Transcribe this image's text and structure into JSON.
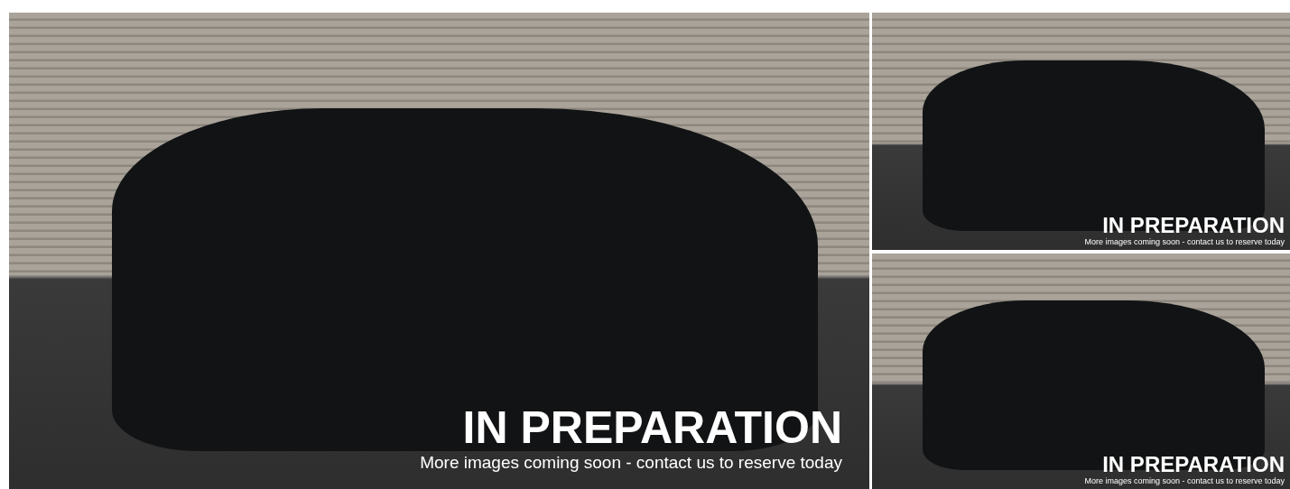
{
  "gallery": [
    {
      "kind": "main",
      "overlay_title": "IN PREPARATION",
      "overlay_text": "More images coming soon - contact us to reserve today"
    },
    {
      "kind": "thumb",
      "overlay_title": "IN PREPARATION",
      "overlay_text": "More images coming soon - contact us to reserve today"
    },
    {
      "kind": "thumb",
      "overlay_title": "IN PREPARATION",
      "overlay_text": "More images coming soon - contact us to reserve today"
    }
  ]
}
